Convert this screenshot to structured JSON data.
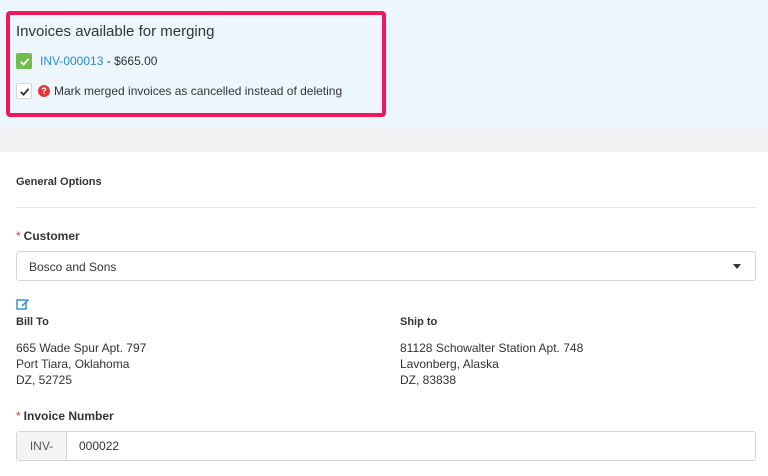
{
  "merge": {
    "title": "Invoices available for merging",
    "invoice_number": "INV-000013",
    "invoice_separator": " - ",
    "invoice_amount": "$665.00",
    "mark_cancelled_label": "Mark merged invoices as cancelled instead of deleting",
    "invoice_checked": true,
    "mark_cancelled_checked": true
  },
  "general": {
    "section_title": "General Options",
    "customer_label": "Customer",
    "customer_value": "Bosco and Sons",
    "bill_to": {
      "title": "Bill To",
      "lines": [
        "665 Wade Spur Apt. 797",
        "Port Tiara, Oklahoma",
        "DZ, 52725"
      ]
    },
    "ship_to": {
      "title": "Ship to",
      "lines": [
        "81128 Schowalter Station Apt. 748",
        "Lavonberg, Alaska",
        "DZ, 83838"
      ]
    },
    "invoice_number_label": "Invoice Number",
    "invoice_prefix": "INV-",
    "invoice_number_value": "000022"
  },
  "colors": {
    "highlight_border": "#f0175b",
    "link": "#2a8bd0",
    "checkbox_green": "#6fbf4a",
    "required": "#e23a3a"
  },
  "icons": [
    "check-icon",
    "question-icon",
    "edit-icon",
    "caret-down-icon"
  ]
}
